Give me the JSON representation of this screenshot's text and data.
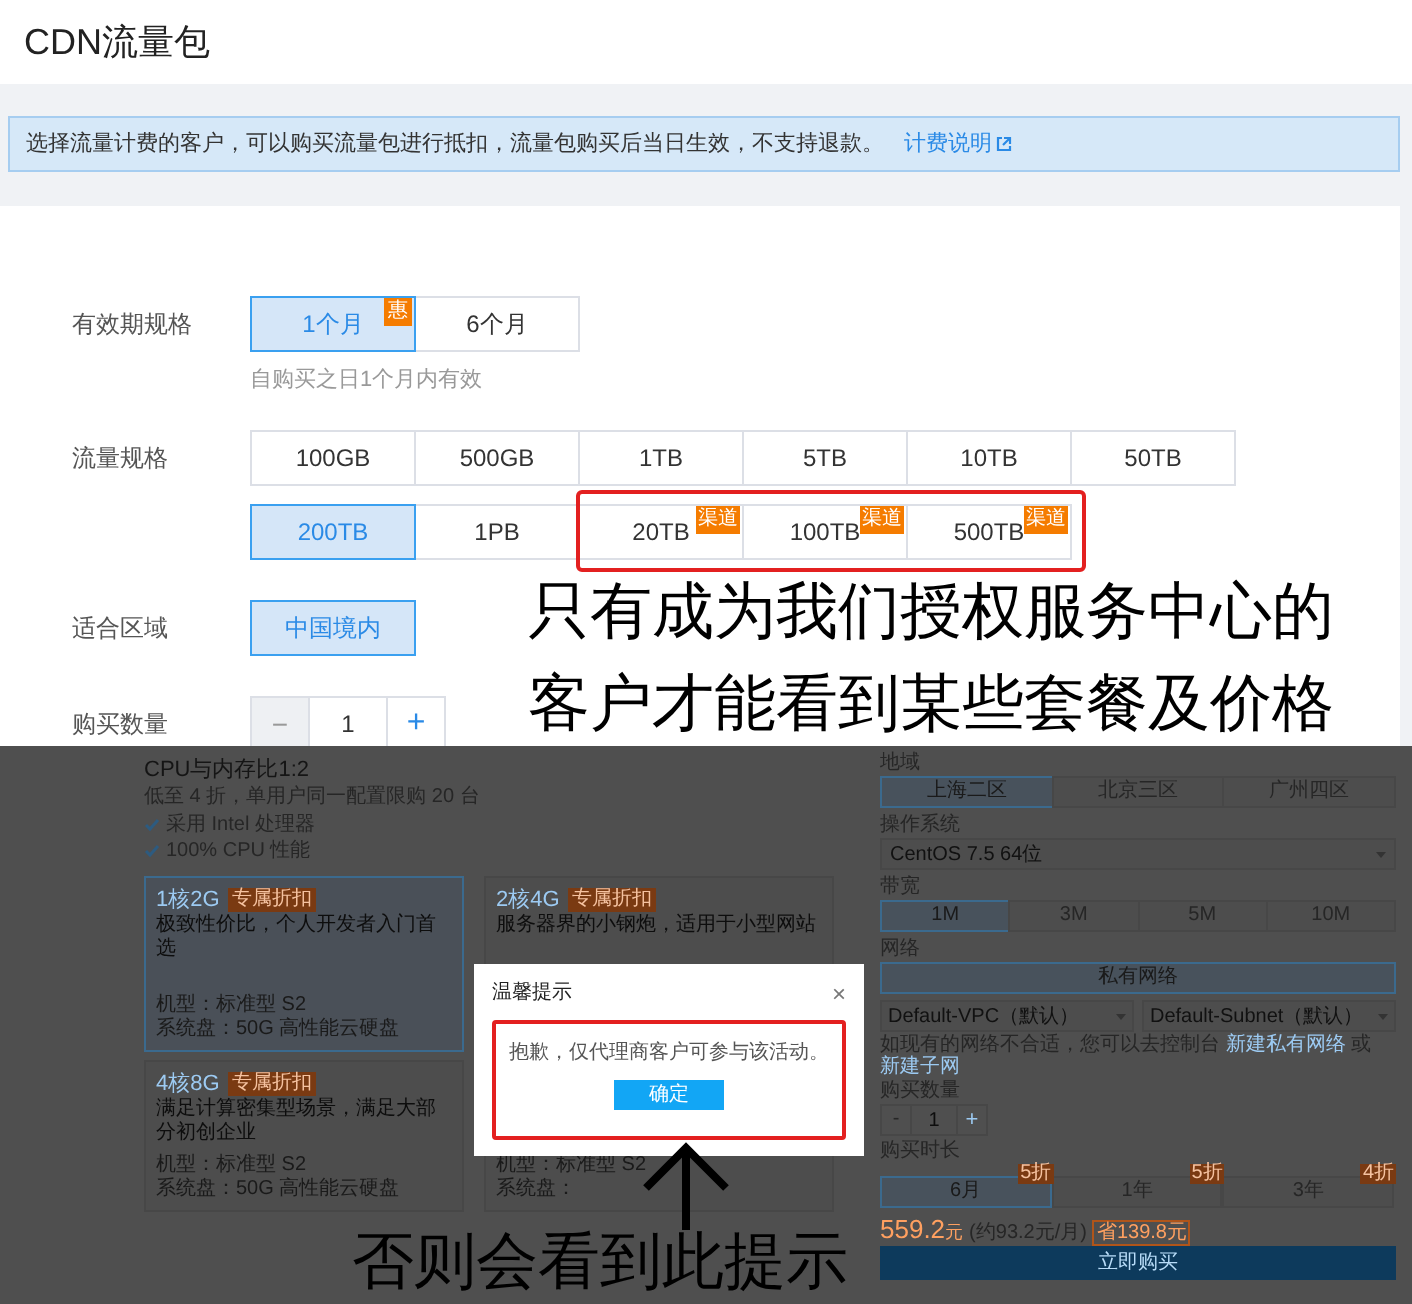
{
  "header": {
    "title": "CDN流量包"
  },
  "notice": {
    "text": "选择流量计费的客户，可以购买流量包进行抵扣，流量包购买后当日生效，不支持退款。",
    "link": "计费说明"
  },
  "form": [
    {
      "kind": "options",
      "label": "有效期规格",
      "rows": [
        [
          {
            "label": "1个月",
            "selected": true,
            "badge": "惠"
          },
          {
            "label": "6个月",
            "selected": false
          }
        ]
      ],
      "hint": "自购买之日1个月内有效"
    },
    {
      "kind": "options",
      "label": "流量规格",
      "rows": [
        [
          {
            "label": "100GB",
            "selected": false,
            "highlighted": false
          },
          {
            "label": "500GB",
            "selected": false,
            "highlighted": false
          },
          {
            "label": "1TB",
            "selected": false,
            "highlighted": false
          },
          {
            "label": "5TB",
            "selected": false,
            "highlighted": false
          },
          {
            "label": "10TB",
            "selected": false,
            "highlighted": false
          },
          {
            "label": "50TB",
            "selected": false,
            "highlighted": false
          }
        ],
        [
          {
            "label": "200TB",
            "selected": true,
            "highlighted": false
          },
          {
            "label": "1PB",
            "selected": false,
            "highlighted": false
          },
          {
            "label": "20TB",
            "selected": false,
            "badge": "渠道",
            "highlighted": true
          },
          {
            "label": "100TB",
            "selected": false,
            "badge": "渠道",
            "highlighted": true
          },
          {
            "label": "500TB",
            "selected": false,
            "badge": "渠道",
            "highlighted": true
          }
        ]
      ]
    },
    {
      "kind": "options",
      "label": "适合区域",
      "rows": [
        [
          {
            "label": "中国境内",
            "selected": true
          }
        ]
      ]
    },
    {
      "kind": "stepper",
      "label": "购买数量",
      "minus": "−",
      "value": "1",
      "plus": "+"
    }
  ],
  "annotation": [
    "只有成为我们授权服务中心的",
    "客户才能看到某些套餐及价格"
  ],
  "screenshot": {
    "left": {
      "title": "CPU与内存比1:2",
      "subtitle": "低至 4 折，单用户同一配置限购 20 台",
      "features": [
        "采用 Intel 处理器",
        "100% CPU 性能"
      ],
      "cards": [
        {
          "name": "1核2G",
          "badge": "专属折扣",
          "desc": "极致性价比，个人开发者入门首选",
          "specs": [
            "机型：标准型 S2",
            "系统盘：50G 高性能云硬盘"
          ],
          "selected": true
        },
        {
          "name": "2核4G",
          "badge": "专属折扣",
          "desc": "服务器界的小钢炮，适用于小型网站",
          "selected": false
        },
        {
          "name": "4核8G",
          "badge": "专属折扣",
          "desc": "满足计算密集型场景，满足大部分初创企业",
          "specs": [
            "机型：标准型 S2",
            "系统盘：50G 高性能云硬盘"
          ],
          "selected": false
        },
        {
          "specs": [
            "机型：标准型 S2",
            "系统盘："
          ],
          "selected": false
        }
      ]
    },
    "right": {
      "sections": [
        {
          "kind": "buttons",
          "label": "地域",
          "options": [
            {
              "label": "上海二区",
              "selected": true
            },
            {
              "label": "北京三区",
              "selected": false
            },
            {
              "label": "广州四区",
              "selected": false
            }
          ]
        },
        {
          "kind": "select",
          "label": "操作系统",
          "value": "CentOS 7.5 64位"
        },
        {
          "kind": "buttons",
          "label": "带宽",
          "options": [
            {
              "label": "1M",
              "selected": true
            },
            {
              "label": "3M",
              "selected": false
            },
            {
              "label": "5M",
              "selected": false
            },
            {
              "label": "10M",
              "selected": false
            }
          ]
        },
        {
          "kind": "network",
          "label": "网络",
          "button": "私有网络",
          "selects": [
            "Default-VPC（默认）",
            "Default-Subnet（默认）"
          ],
          "note": "如现有的网络不合适，您可以去控制台",
          "links": [
            "新建私有网络",
            "新建子网"
          ],
          "joiner": "或"
        },
        {
          "kind": "stepper",
          "label": "购买数量",
          "minus": "-",
          "value": "1",
          "plus": "+"
        },
        {
          "kind": "buttons",
          "label": "购买时长",
          "options": [
            {
              "label": "6月",
              "selected": true,
              "badge": "5折"
            },
            {
              "label": "1年",
              "selected": false,
              "badge": "5折"
            },
            {
              "label": "3年",
              "selected": false,
              "badge": "4折"
            }
          ]
        }
      ],
      "price": "559.2",
      "price_unit": "元",
      "monthly": "(约93.2元/月)",
      "saving": "省139.8元",
      "buy": "立即购买"
    },
    "dialog": {
      "title": "温馨提示",
      "close": "×",
      "message": "抱歉，仅代理商客户可参与该活动。",
      "confirm": "确定"
    }
  },
  "caption": "否则会看到此提示"
}
